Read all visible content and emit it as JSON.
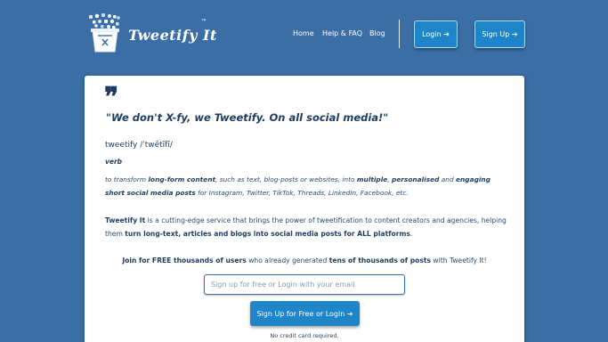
{
  "brand": {
    "name": "Tweetify It",
    "tm": "™",
    "logo_icon": "cup-with-social-icons-icon"
  },
  "nav": {
    "home": "Home",
    "help": "Help & FAQ",
    "blog": "Blog"
  },
  "header_buttons": {
    "login": "Login ➔",
    "signup": "Sign Up ➔"
  },
  "hero": {
    "quote_mark": "❞",
    "headline": "\"We don't X-fy, we Tweetify. On all social media!\""
  },
  "definition": {
    "word": "tweetify /ˈtwētĭfī/",
    "part_of_speech": "verb",
    "parts": [
      "to transform ",
      "long-form content",
      ", such as text, blog-posts or websites, into ",
      "multiple",
      ", ",
      "personalised",
      " and ",
      "engaging short social media posts",
      " for Instagram, Twitter, TikTok, Threads, LinkedIn, Facebook, etc."
    ]
  },
  "description": {
    "parts": [
      "Tweetify It",
      " is a cutting-edge service that brings the power of tweetification to content creators and agencies, helping them ",
      "turn long-text, articles and blogs into social media posts for ALL platforms",
      "."
    ]
  },
  "join": {
    "parts": [
      "Join for FREE thousands of users",
      " who already generated ",
      "tens of thousands of posts",
      " with Tweetify It!"
    ]
  },
  "signup_form": {
    "email_placeholder": "Sign up for free or Login with your email",
    "cta_label": "Sign Up for Free or Login ➔",
    "note": "No credit card required."
  },
  "colors": {
    "background": "#3a6ea5",
    "button": "#1e86c8",
    "text_dark": "#1e3c5e",
    "card": "#ffffff"
  }
}
